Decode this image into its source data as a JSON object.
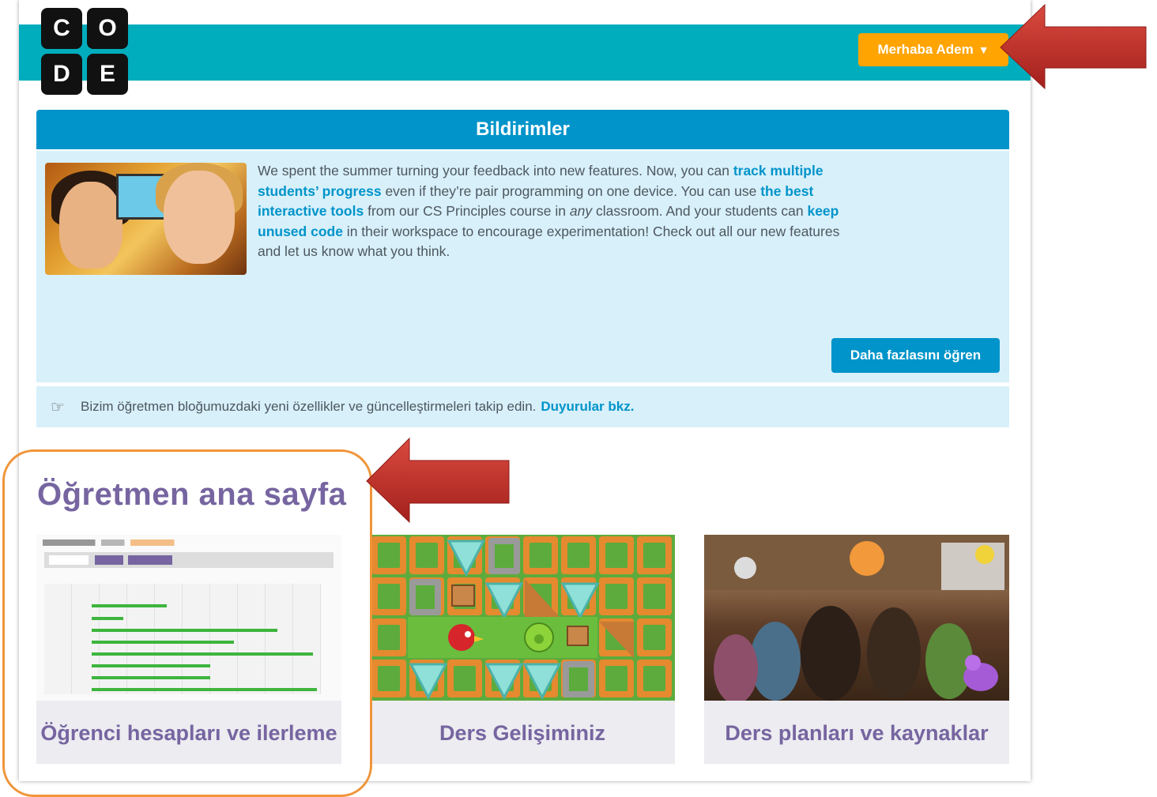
{
  "logo": {
    "letters": [
      "C",
      "O",
      "D",
      "E"
    ]
  },
  "header": {
    "user_menu_label": "Merhaba Adem",
    "user_menu_caret": "▼"
  },
  "notifications": {
    "title": "Bildirimler",
    "body": {
      "t1": "We spent the summer turning your feedback into new features. Now, you can ",
      "link1": "track multiple students’ progress",
      "t2": " even if they’re pair programming on one device. You can use ",
      "link2": "the best interactive tools",
      "t3": " from our CS Principles course in ",
      "em": "any",
      "t4": " classroom. And your students can ",
      "link3": "keep unused code",
      "t5": " in their workspace to encourage experimentation! Check out all our new features and let us know what you think."
    },
    "learn_more_button": "Daha fazlasını öğren"
  },
  "blog": {
    "text": "Bizim öğretmen bloğumuzdaki yeni özellikler ve güncelleştirmeleri takip edin.",
    "link": "Duyurular bkz."
  },
  "teacher_home": {
    "title": "Öğretmen ana sayfa",
    "cards": [
      {
        "label": "Öğrenci hesapları ve ilerleme"
      },
      {
        "label": "Ders Gelişiminiz"
      },
      {
        "label": "Ders planları ve kaynaklar"
      }
    ]
  },
  "colors": {
    "teal_header": "#00adbc",
    "orange_menu": "#ffa400",
    "blue_primary": "#0094ca",
    "notification_bg": "#d8f0fa",
    "purple_title": "#7665a0",
    "annotation_arrow": "#c0302c",
    "annotation_box": "#f0953a"
  }
}
